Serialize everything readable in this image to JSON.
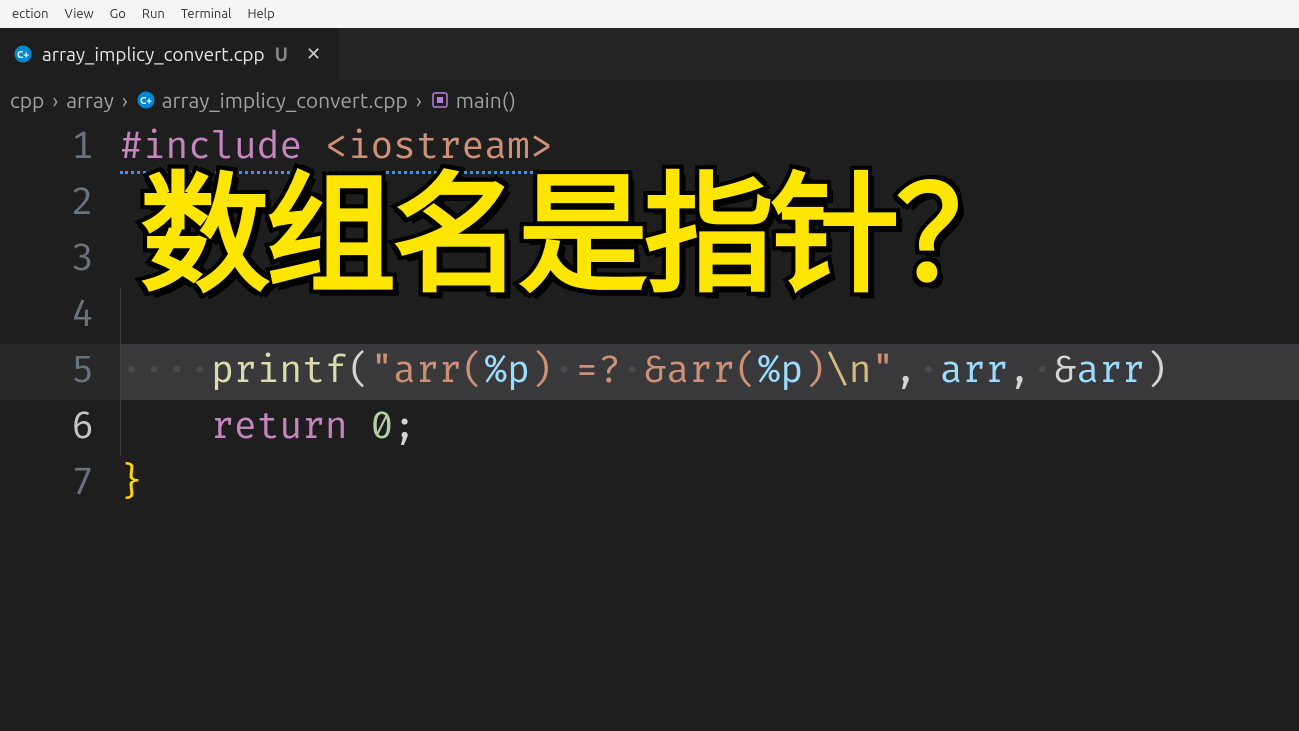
{
  "menu": {
    "items": [
      "ection",
      "View",
      "Go",
      "Run",
      "Terminal",
      "Help"
    ]
  },
  "tab": {
    "filename": "array_implicy_convert.cpp",
    "status": "U",
    "close": "✕"
  },
  "breadcrumbs": {
    "items": [
      "cpp",
      "array",
      "array_implicy_convert.cpp",
      "main()"
    ]
  },
  "overlay": {
    "text": "数组名是指针？"
  },
  "code": {
    "lines": [
      {
        "n": "1"
      },
      {
        "n": "2"
      },
      {
        "n": "3"
      },
      {
        "n": "4"
      },
      {
        "n": "5"
      },
      {
        "n": "6"
      },
      {
        "n": "7"
      }
    ],
    "line1": {
      "pre": "#include",
      "sp": " ",
      "inc": "<iostream>"
    },
    "line5": {
      "func": "printf",
      "op1": "(",
      "q1": "\"",
      "s1": "arr(",
      "f1": "%p",
      "s2": ")",
      "sp1": " ",
      "s3": "=?",
      "sp2": " ",
      "s4": "&arr(",
      "f2": "%p",
      "s5": ")",
      "esc": "\\n",
      "q2": "\"",
      "c1": ",",
      "sp3": " ",
      "v1": "arr",
      "c2": ",",
      "sp4": " ",
      "amp": "&",
      "v2": "arr",
      "op2": ")"
    },
    "line6": {
      "kw": "return",
      "sp": " ",
      "num": "0",
      "semi": ";"
    },
    "line7": {
      "brace": "}"
    }
  }
}
